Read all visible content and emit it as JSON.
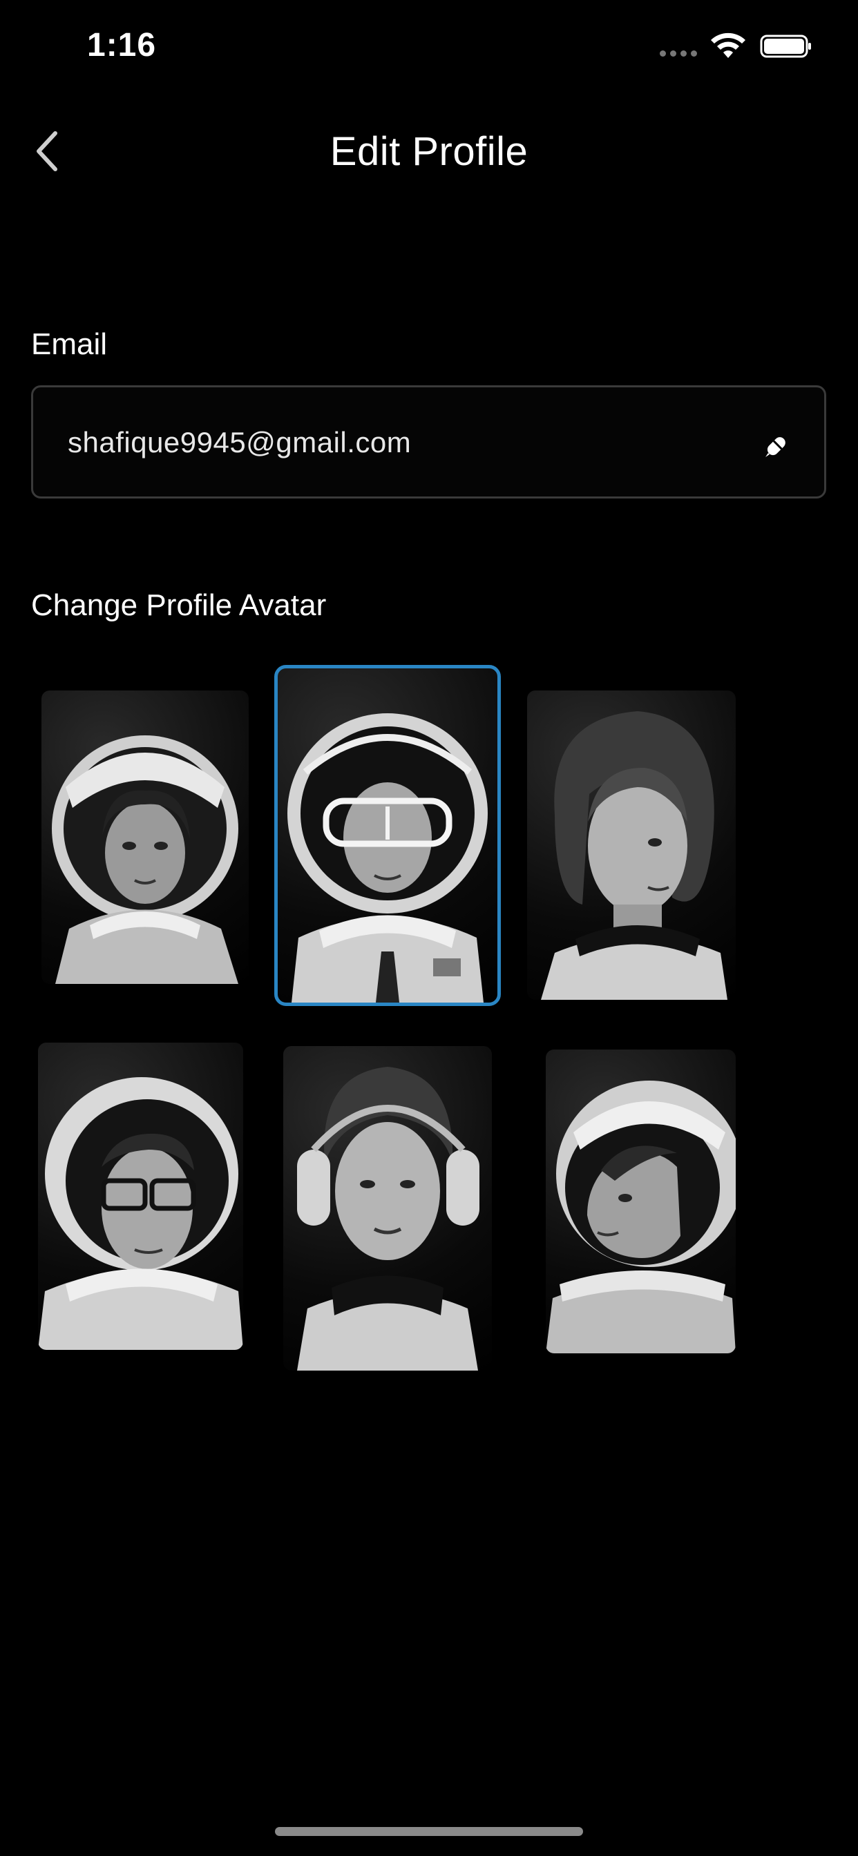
{
  "status_bar": {
    "time": "1:16",
    "icons": [
      "signal-dots-icon",
      "wifi-icon",
      "battery-icon"
    ]
  },
  "nav": {
    "back_icon": "chevron-left-icon",
    "title": "Edit Profile"
  },
  "email": {
    "label": "Email",
    "value": "shafique9945@gmail.com",
    "edit_icon": "pencil-icon"
  },
  "avatars": {
    "heading": "Change Profile Avatar",
    "selected_index": 1,
    "selection_color": "#2a86c4",
    "items": [
      {
        "description": "female-astronaut-helmet-portrait"
      },
      {
        "description": "male-astronaut-goggles-portrait"
      },
      {
        "description": "female-astronaut-side-portrait"
      },
      {
        "description": "male-astronaut-glasses-portrait"
      },
      {
        "description": "female-astronaut-headset-portrait"
      },
      {
        "description": "male-astronaut-profile-portrait"
      }
    ]
  }
}
